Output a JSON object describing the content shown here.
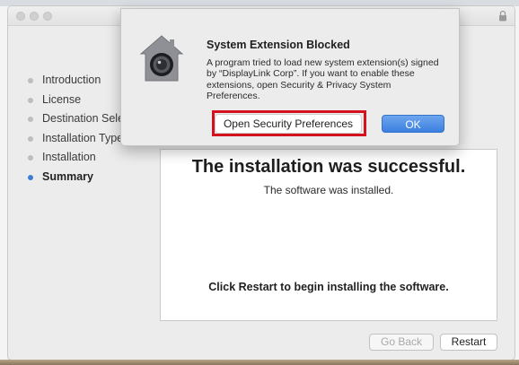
{
  "installer": {
    "steps": [
      {
        "label": "Introduction",
        "active": false
      },
      {
        "label": "License",
        "active": false
      },
      {
        "label": "Destination Select",
        "active": false
      },
      {
        "label": "Installation Type",
        "active": false
      },
      {
        "label": "Installation",
        "active": false
      },
      {
        "label": "Summary",
        "active": true
      }
    ],
    "headline": "The installation was successful.",
    "subline": "The software was installed.",
    "restart_message": "Click Restart to begin installing the software.",
    "go_back_label": "Go Back",
    "restart_label": "Restart"
  },
  "alert": {
    "title": "System Extension Blocked",
    "body": "A program tried to load new system extension(s) signed by “DisplayLink Corp”.  If you want to enable these extensions, open Security & Privacy System Preferences.",
    "open_button_label": "Open Security Preferences",
    "ok_label": "OK",
    "icon": "security-house-icon"
  },
  "colors": {
    "accent": "#3d7fd4",
    "highlight_border": "#d4111e"
  }
}
